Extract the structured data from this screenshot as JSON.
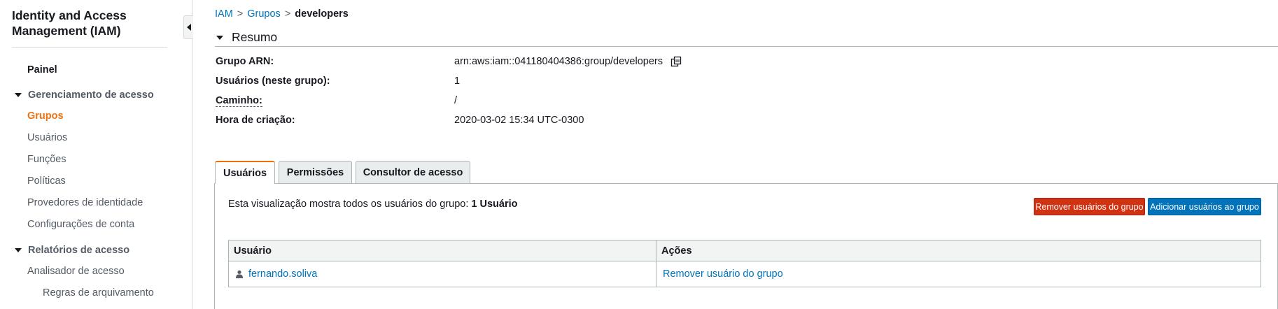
{
  "sidebar": {
    "title": "Identity and Access Management (IAM)",
    "dashboard": "Painel",
    "access_management": {
      "label": "Gerenciamento de acesso",
      "items": [
        "Grupos",
        "Usuários",
        "Funções",
        "Políticas",
        "Provedores de identidade",
        "Configurações de conta"
      ],
      "active": "Grupos"
    },
    "access_reports": {
      "label": "Relatórios de acesso",
      "items": [
        "Analisador de acesso"
      ],
      "sub_items": [
        "Regras de arquivamento"
      ]
    }
  },
  "breadcrumb": {
    "items": [
      "IAM",
      "Grupos"
    ],
    "current": "developers",
    "separator": ">"
  },
  "summary": {
    "title": "Resumo",
    "fields": [
      {
        "label": "Grupo ARN:",
        "value": "arn:aws:iam::041180404386:group/developers"
      },
      {
        "label": "Usuários (neste grupo):",
        "value": "1"
      },
      {
        "label": "Caminho:",
        "value": "/"
      },
      {
        "label": "Hora de criação:",
        "value": "2020-03-02 15:34 UTC-0300"
      }
    ]
  },
  "tabs": [
    {
      "label": "Usuários",
      "active": true
    },
    {
      "label": "Permissões",
      "active": false
    },
    {
      "label": "Consultor de acesso",
      "active": false
    }
  ],
  "users_panel": {
    "description": "Esta visualização mostra todos os usuários do grupo: ",
    "count_text": "1 Usuário",
    "remove_button": "Remover usuários do grupo",
    "add_button": "Adicionar usuários ao grupo",
    "table": {
      "columns": [
        "Usuário",
        "Ações"
      ],
      "rows": [
        {
          "user": "fernando.soliva",
          "action": "Remover usuário do grupo"
        }
      ]
    }
  },
  "colors": {
    "accent": "#ec7211",
    "link": "#0073bb",
    "danger": "#d13212",
    "primary": "#0073bb"
  }
}
